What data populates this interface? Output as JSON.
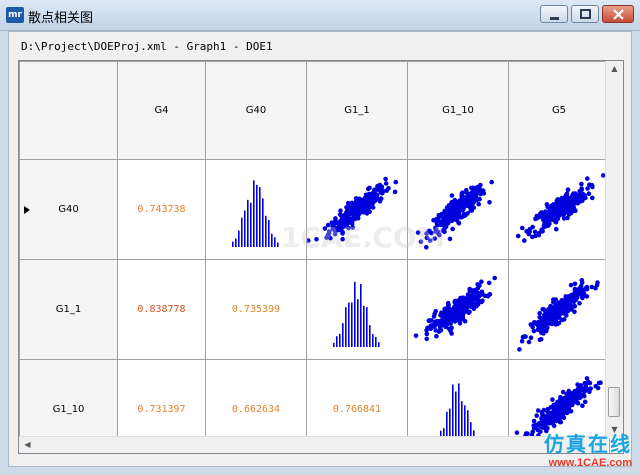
{
  "window": {
    "app_icon_text": "mr",
    "title": "散点相关图"
  },
  "path_label": "D:\\Project\\DOEProj.xml - Graph1 - DOE1",
  "columns": [
    "G4",
    "G40",
    "G1_1",
    "G1_10",
    "G5"
  ],
  "rows": [
    {
      "label": "G40",
      "cells": [
        {
          "kind": "corr",
          "value": "0.743738"
        },
        {
          "kind": "hist"
        },
        {
          "kind": "scatter"
        },
        {
          "kind": "scatter"
        },
        {
          "kind": "scatter"
        }
      ]
    },
    {
      "label": "G1_1",
      "cells": [
        {
          "kind": "corr",
          "value": "0.838778"
        },
        {
          "kind": "corr",
          "value": "0.735399"
        },
        {
          "kind": "hist"
        },
        {
          "kind": "scatter"
        },
        {
          "kind": "scatter"
        }
      ]
    },
    {
      "label": "G1_10",
      "cells": [
        {
          "kind": "corr",
          "value": "0.731397"
        },
        {
          "kind": "corr",
          "value": "0.662634"
        },
        {
          "kind": "corr",
          "value": "0.766841"
        },
        {
          "kind": "hist"
        },
        {
          "kind": "scatter"
        }
      ]
    }
  ],
  "colors": {
    "corr_text": "#e0842a",
    "corr_text_high": "#d9531e",
    "marker": "#0000dd",
    "grid_line": "#a0a0a0"
  },
  "watermark_text": "1CAE.COM",
  "brand": {
    "cn": "仿真在线",
    "url": "www.1CAE.com"
  }
}
